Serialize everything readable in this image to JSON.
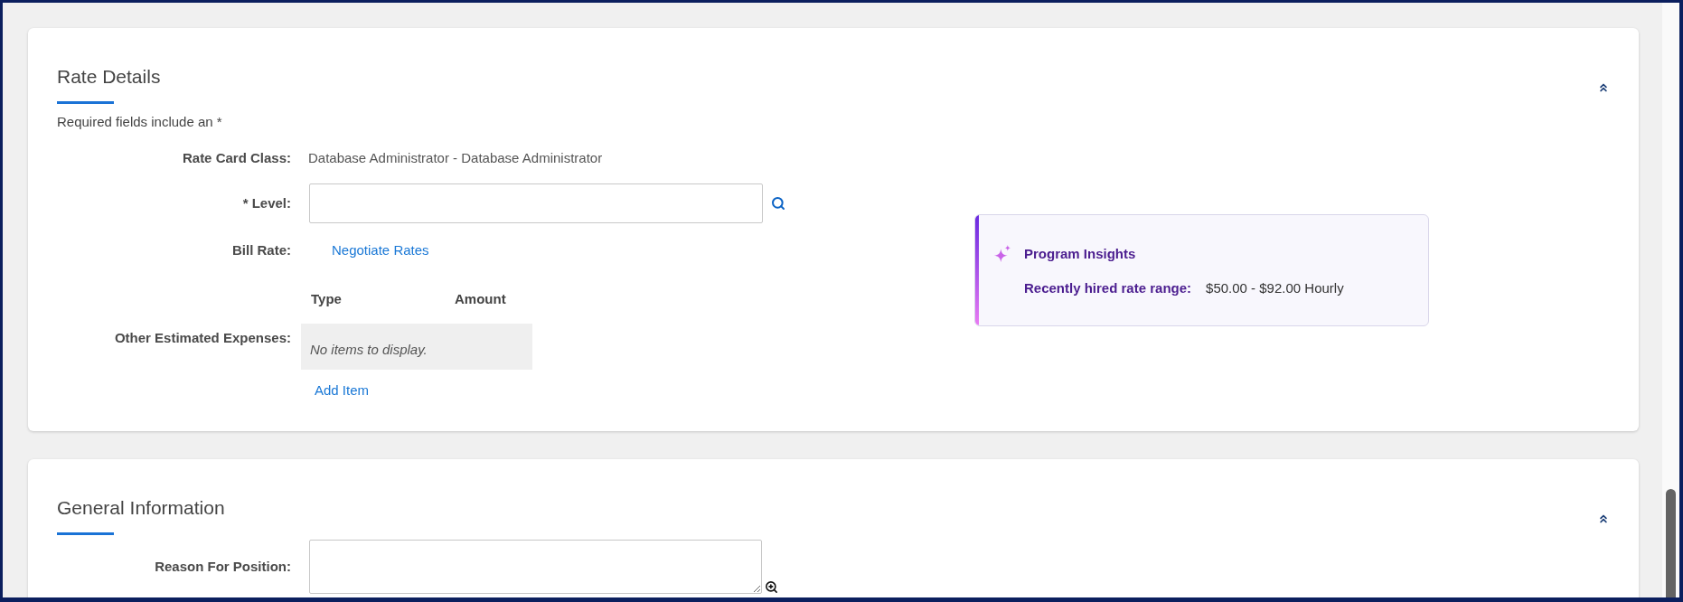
{
  "sections": [
    {
      "title": "Rate Details",
      "expanded": true,
      "required_note": "Required fields include an *",
      "fields": [
        {
          "kind": "text",
          "label": "Rate Card Class:",
          "value": "Database Administrator - Database Administrator"
        },
        {
          "kind": "lookup",
          "label": "* Level:"
        },
        {
          "kind": "link",
          "label": "Bill Rate:",
          "link": "Negotiate Rates"
        },
        {
          "kind": "table",
          "label": "Other Estimated Expenses:",
          "columns": [
            "Type",
            "Amount"
          ],
          "empty_message": "No items to display.",
          "action": "Add Item"
        }
      ],
      "insights": {
        "title": "Program Insights",
        "label": "Recently hired rate range:",
        "value": "$50.00 - $92.00 Hourly"
      }
    },
    {
      "title": "General Information",
      "expanded": true,
      "fields": [
        {
          "kind": "textarea",
          "label": "Reason For Position:"
        }
      ]
    }
  ]
}
